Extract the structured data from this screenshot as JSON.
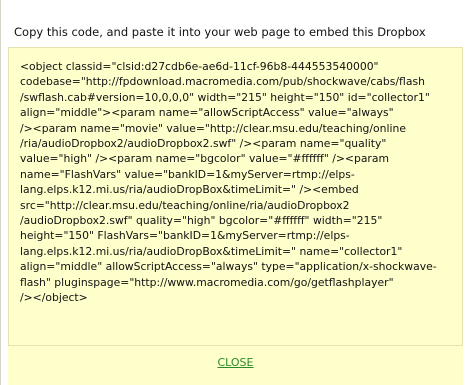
{
  "dialog": {
    "instruction": "Copy this code, and paste it into your web page to embed this Dropbox",
    "code_lines": [
      "<object classid=\"clsid:d27cdb6e-ae6d-11cf-96b8-444553540000\"",
      "codebase=\"http://fpdownload.macromedia.com/pub/shockwave/cabs/flash",
      "/swflash.cab#version=10,0,0,0\" width=\"215\" height=\"150\" id=\"collector1\"",
      "align=\"middle\"><param name=\"allowScriptAccess\" value=\"always\"",
      "/><param name=\"movie\" value=\"http://clear.msu.edu/teaching/online",
      "/ria/audioDropbox2/audioDropbox2.swf\" /><param name=\"quality\"",
      "value=\"high\" /><param name=\"bgcolor\" value=\"#ffffff\" /><param",
      "name=\"FlashVars\" value=\"bankID=1&myServer=rtmp://elps-",
      "lang.elps.k12.mi.us/ria/audioDropBox&timeLimit=\" /><embed",
      "src=\"http://clear.msu.edu/teaching/online/ria/audioDropbox2",
      "/audioDropbox2.swf\" quality=\"high\" bgcolor=\"#ffffff\" width=\"215\"",
      "height=\"150\" FlashVars=\"bankID=1&myServer=rtmp://elps-",
      "lang.elps.k12.mi.us/ria/audioDropBox&timeLimit=\" name=\"collector1\"",
      "align=\"middle\" allowScriptAccess=\"always\" type=\"application/x-shockwave-",
      "flash\" pluginspage=\"http://www.macromedia.com/go/getflashplayer\"",
      "/></object>"
    ],
    "close_label": "CLOSE"
  },
  "colors": {
    "code_background": "#ffffcc",
    "link": "#2a8a2a",
    "text": "#111111"
  }
}
